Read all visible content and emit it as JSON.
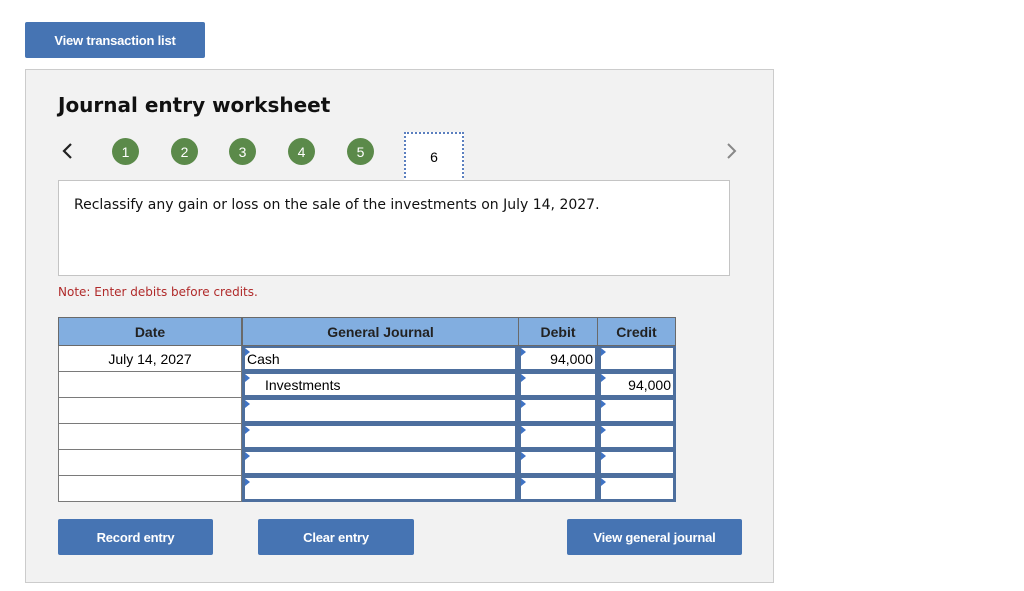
{
  "top_button": {
    "label": "View transaction list"
  },
  "worksheet": {
    "title": "Journal entry worksheet",
    "prev_icon": "chevron-left-icon",
    "next_icon": "chevron-right-icon",
    "steps": [
      {
        "label": "1",
        "status": "completed"
      },
      {
        "label": "2",
        "status": "completed"
      },
      {
        "label": "3",
        "status": "completed"
      },
      {
        "label": "4",
        "status": "completed"
      },
      {
        "label": "5",
        "status": "completed"
      },
      {
        "label": "6",
        "status": "current"
      }
    ],
    "question": "Reclassify any gain or loss on the sale of the investments on July 14, 2027.",
    "note": "Note: Enter debits before credits.",
    "step_color": "#5b8a4a",
    "accent_color": "#4674b3",
    "note_color": "#b02a2a"
  },
  "journal": {
    "headers": {
      "date": "Date",
      "account": "General Journal",
      "debit": "Debit",
      "credit": "Credit"
    },
    "rows": [
      {
        "date": "July 14, 2027",
        "account": "Cash",
        "debit": "94,000",
        "credit": ""
      },
      {
        "date": "",
        "account": "Investments",
        "debit": "",
        "credit": "94,000"
      },
      {
        "date": "",
        "account": "",
        "debit": "",
        "credit": ""
      },
      {
        "date": "",
        "account": "",
        "debit": "",
        "credit": ""
      },
      {
        "date": "",
        "account": "",
        "debit": "",
        "credit": ""
      },
      {
        "date": "",
        "account": "",
        "debit": "",
        "credit": ""
      }
    ]
  },
  "actions": {
    "record": "Record entry",
    "clear": "Clear entry",
    "view_journal": "View general journal"
  }
}
